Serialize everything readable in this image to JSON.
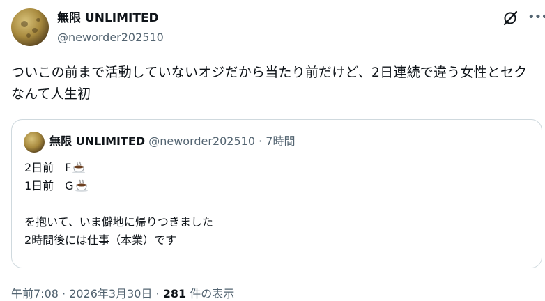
{
  "post": {
    "author_name": "無限 UNLIMITED",
    "handle": "@neworder202510",
    "text": "ついこの前まで活動していないオジだから当たり前だけど、2日連続で違う女性とセクなんて人生初"
  },
  "quote": {
    "author_name": "無限 UNLIMITED",
    "handle": "@neworder202510",
    "separator": " · ",
    "time": "7時間",
    "lines": [
      {
        "text": "2日前　F",
        "emoji": "coffee-icon"
      },
      {
        "text": "1日前　G",
        "emoji": "coffee-icon"
      },
      {
        "text": ""
      },
      {
        "text": "を抱いて、いま僻地に帰りつきました"
      },
      {
        "text": "2時間後には仕事（本業）です"
      }
    ]
  },
  "footer": {
    "timestamp": "午前7:08 · 2026年3月30日",
    "separator": " · ",
    "views_count": "281",
    "views_label": "件の表示"
  },
  "icons": {
    "grok": "grok-icon",
    "more": "more-icon"
  },
  "colors": {
    "text": "#0f1419",
    "secondary": "#536471",
    "border": "#cfd9de"
  }
}
